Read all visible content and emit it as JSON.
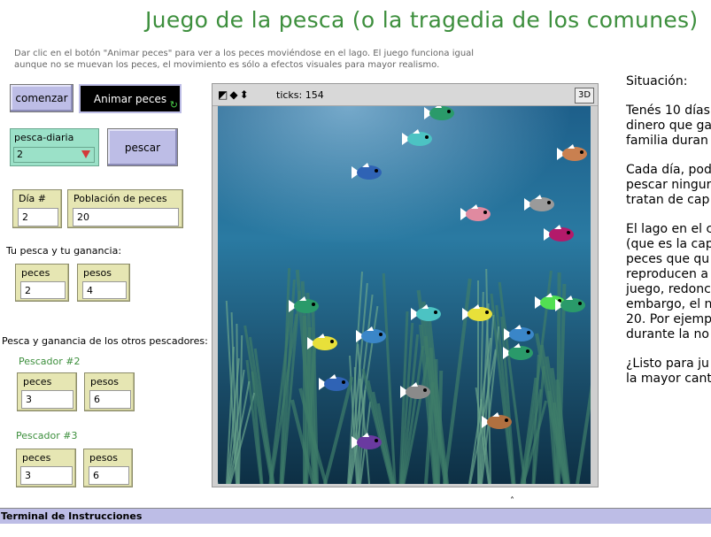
{
  "title": "Juego de la pesca (o la tragedia de los comunes)",
  "intro": "Dar clic en el botón \"Animar peces\" para ver a los peces moviéndose en el lago. El juego funciona igual aunque no se muevan los peces, el movimiento es sólo a efectos visuales para mayor realismo.",
  "buttons": {
    "comenzar": "comenzar",
    "animar": "Animar peces",
    "pescar": "pescar"
  },
  "chooser": {
    "label": "pesca-diaria",
    "value": "2"
  },
  "dia": {
    "label": "Día #",
    "value": "2"
  },
  "poblacion": {
    "label": "Población de peces",
    "value": "20"
  },
  "tu_pesca": {
    "heading": "Tu pesca y tu ganancia:",
    "peces_label": "peces",
    "peces_value": "2",
    "pesos_label": "pesos",
    "pesos_value": "4"
  },
  "otros": {
    "heading": "Pesca y ganancia de los otros pescadores:",
    "p2": {
      "name": "Pescador #2",
      "peces_label": "peces",
      "peces_value": "3",
      "pesos_label": "pesos",
      "pesos_value": "6"
    },
    "p3": {
      "name": "Pescador #3",
      "peces_label": "peces",
      "peces_value": "3",
      "pesos_label": "pesos",
      "pesos_value": "6"
    }
  },
  "view": {
    "ticks": "ticks: 154",
    "three_d": "3D"
  },
  "situacion": {
    "p1": "Situación:",
    "p2": [
      "Tenés 10 días",
      "dinero que ga",
      "familia duran"
    ],
    "p3": [
      "Cada día, pod",
      "pescar ningur",
      "tratan de cap"
    ],
    "p4": [
      "El lago en el c",
      "(que es la cap",
      "peces que qu",
      "reproducen a",
      "juego, redonc",
      "embargo, el n",
      "20. Por ejemp",
      "durante la no"
    ],
    "p5": [
      "¿Listo para ju",
      "la mayor cant"
    ]
  },
  "terminal": "Terminal de Instrucciones",
  "colors": {
    "title": "#3d8f3d",
    "button": "#bdbde6",
    "monitor": "#e6e6b3",
    "chooser": "#9be1c8"
  },
  "fish": [
    {
      "color": "#2a9a6a"
    },
    {
      "color": "#4cc3c3"
    },
    {
      "color": "#c98050"
    },
    {
      "color": "#2f63b5"
    },
    {
      "color": "#9a9a9a"
    },
    {
      "color": "#e08aa0"
    },
    {
      "color": "#b31a6a"
    },
    {
      "color": "#2a9a6a"
    },
    {
      "color": "#52e052"
    },
    {
      "color": "#2a9a6a"
    },
    {
      "color": "#4cc3c3"
    },
    {
      "color": "#e8e03a"
    },
    {
      "color": "#e8e03a"
    },
    {
      "color": "#3a86c8"
    },
    {
      "color": "#3a86c8"
    },
    {
      "color": "#2a9a6a"
    },
    {
      "color": "#2f63b5"
    },
    {
      "color": "#8a8a8a"
    },
    {
      "color": "#b07040"
    },
    {
      "color": "#6a3aa0"
    }
  ]
}
